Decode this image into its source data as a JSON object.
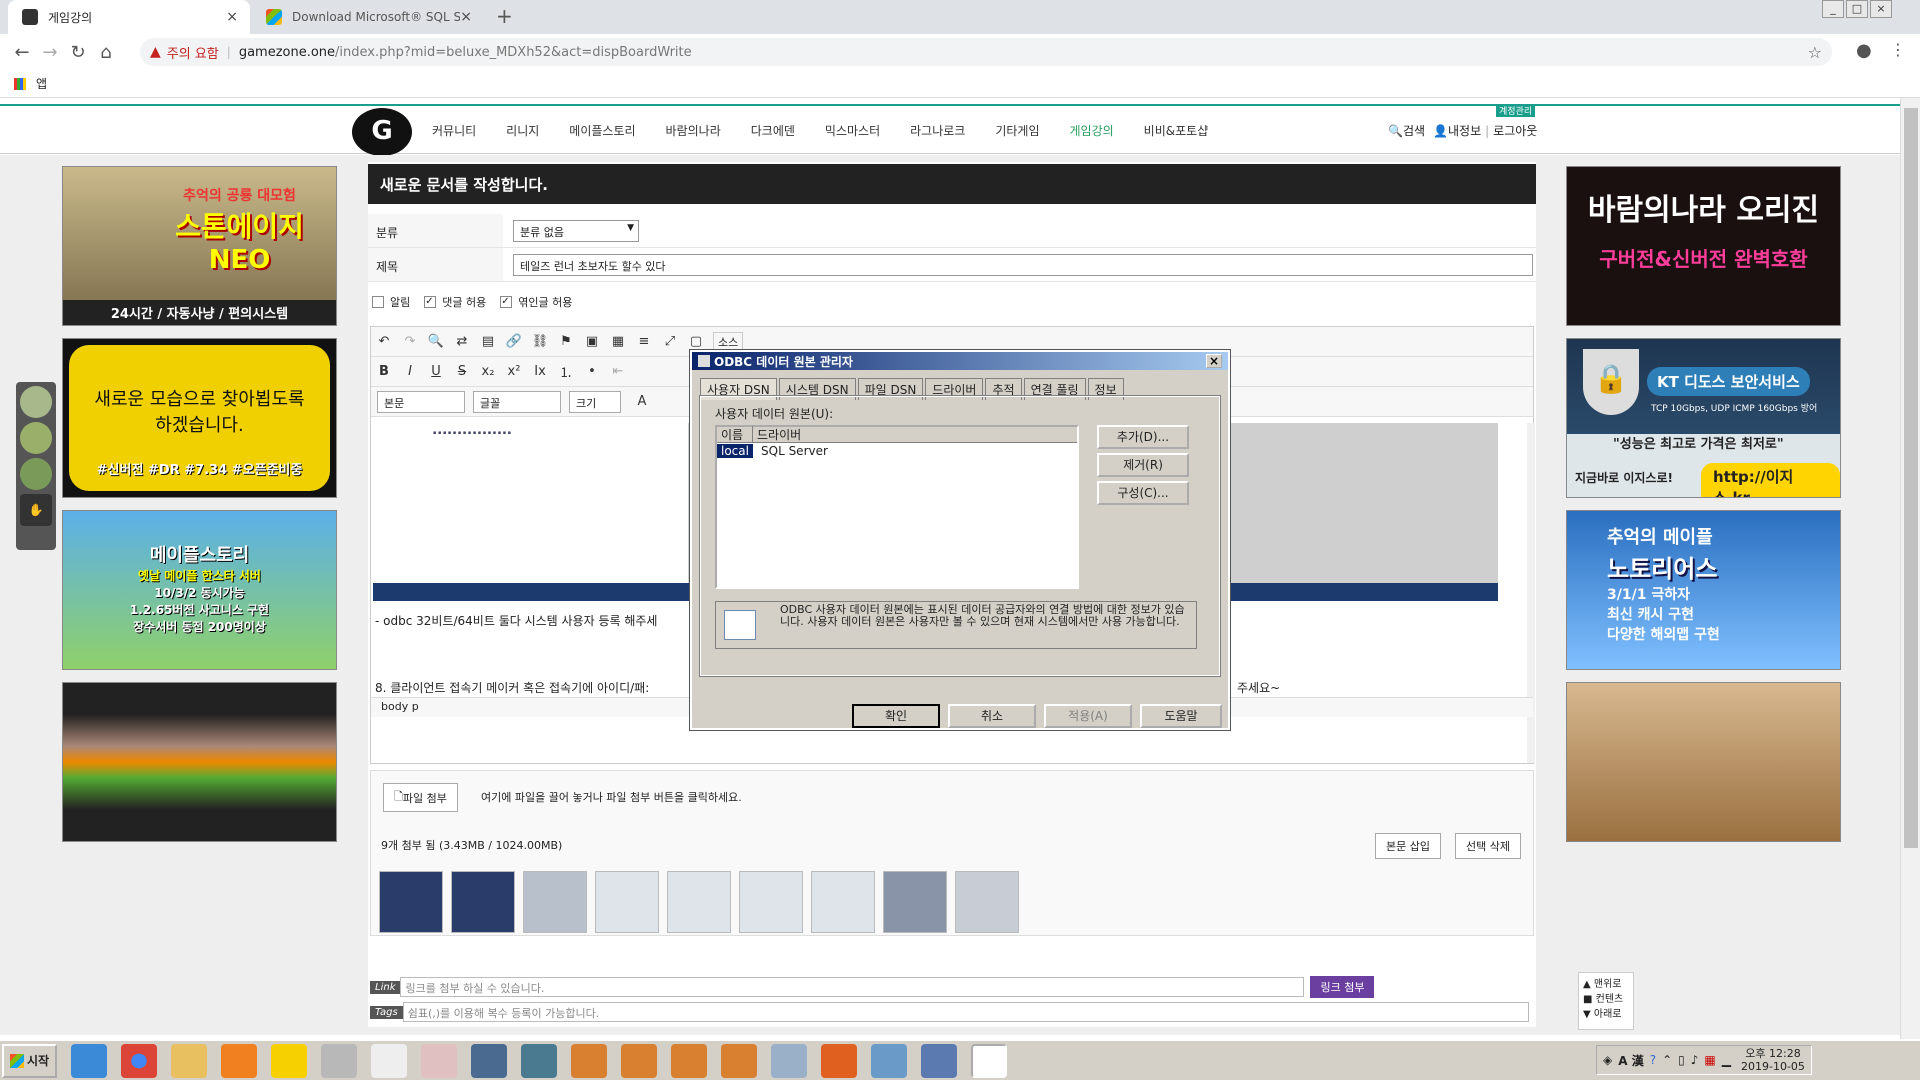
{
  "browser": {
    "tabs": [
      {
        "title": "게임강의",
        "close": "×"
      },
      {
        "title": "Download Microsoft® SQL Ser",
        "close": "×"
      }
    ],
    "new_tab": "+",
    "security_warning": "주의 요함",
    "url_host": "gamezone.one",
    "url_path": "/index.php?mid=beluxe_MDXh52&act=dispBoardWrite",
    "bookmark_apps": "앱",
    "window_controls": [
      "_",
      "□",
      "×"
    ]
  },
  "site": {
    "menu": [
      "커뮤니티",
      "리니지",
      "메이플스토리",
      "바람의나라",
      "다크에덴",
      "믹스마스터",
      "라그나로크",
      "기타게임",
      "게임강의",
      "비비&포토샵"
    ],
    "active_menu": "게임강의",
    "header_links": {
      "search": "검색",
      "myinfo": "내정보",
      "logout": "로그아웃"
    },
    "new_badge": "계정관리"
  },
  "left_ads": [
    {
      "top": "추억의 공룡 대모험",
      "title": "스톤에이지",
      "sub": "NEO",
      "footer": "24시간 / 자동사냥 / 편의시스템"
    },
    {
      "title": "새로운 모습으로 찾아뵙도록 하겠습니다.",
      "footer": "#신버전 #DR #7.34 #오픈준비중"
    },
    {
      "title": "메이플스토리",
      "line1": "옛날 메이플 한스타 서버",
      "line2": "10/3/2 동시가능",
      "line3": "1.2.65버전 사고니스 구현",
      "line4": "장수서버 동접 200명이상"
    },
    {
      "title": ""
    }
  ],
  "right_ads": [
    {
      "title": "바람의나라 오리진",
      "sub": "구버전&신버전 완벽호환"
    },
    {
      "title": "KT 디도스 보안서비스",
      "spec": "TCP 10Gbps, UDP ICMP 160Gbps 방어",
      "slogan": "\"성능은 최고로 가격은 최저로\"",
      "cta_label": "지금바로 이지스로!",
      "cta": "http://이지스.kr"
    },
    {
      "title": "추억의 메이플",
      "sub": "노토리어스",
      "line1": "3/1/1 극하자",
      "line2": "최신 캐시 구현",
      "line3": "다양한 해외맵 구현"
    },
    {
      "title": ""
    }
  ],
  "editor": {
    "page_title": "새로운 문서를 작성합니다.",
    "category_label": "분류",
    "category_value": "분류 없음",
    "subject_label": "제목",
    "subject_value": "테일즈 런너 초보자도 할수 있다",
    "opt_notice": "알림",
    "opt_comment": "댓글 허용",
    "opt_trackback": "엮인글 허용",
    "source_label": "소스",
    "format_select": "본문",
    "font_select": "글꼴",
    "size_select": "크기",
    "body_line1": "- odbc 32비트/64비트 둘다 시스템 사용자 등록 해주세",
    "body_line2": "8. 클라이언트 접속기 메이커 혹은 접속기에 아이디/패:",
    "body_line2_tail": "주세요~",
    "status_path": "body  p",
    "file_attach_btn": "파일 첨부",
    "file_drop_hint": "여기에 파일을 끌어 놓거나 파일 첨부 버튼을 클릭하세요.",
    "file_count": "9개 첨부 됨 (3.43MB / 1024.00MB)",
    "insert_btn": "본문 삽입",
    "delete_btn": "선택 삭제",
    "link_tag": "Link",
    "link_placeholder": "링크를 첨부 하실 수 있습니다.",
    "link_btn": "링크 첨부",
    "tags_tag": "Tags",
    "tags_placeholder": "쉼표(,)를 이용해 복수 등록이 가능합니다."
  },
  "float_menu": [
    "▲ 맨위로",
    "■ 컨텐츠",
    "▼ 아래로"
  ],
  "dialog": {
    "title": "ODBC 데이터 원본 관리자",
    "tabs": [
      "사용자 DSN",
      "시스템 DSN",
      "파일 DSN",
      "드라이버",
      "추적",
      "연결 풀링",
      "정보"
    ],
    "list_label": "사용자 데이터 원본(U):",
    "col_name": "이름",
    "col_driver": "드라이버",
    "row_name": "local",
    "row_driver": "SQL Server",
    "btn_add": "추가(D)...",
    "btn_remove": "제거(R)",
    "btn_config": "구성(C)...",
    "info_text": "ODBC 사용자 데이터 원본에는 표시된 데이터 공급자와의 연결 방법에 대한 정보가 있습니다. 사용자 데이터 원본은 사용자만 볼 수 있으며 현재 시스템에서만 사용 가능합니다.",
    "btn_ok": "확인",
    "btn_cancel": "취소",
    "btn_apply": "적용(A)",
    "btn_help": "도움말"
  },
  "taskbar": {
    "start": "시작",
    "tray_lang": "A 漢",
    "clock_time": "오후 12:28",
    "clock_date": "2019-10-05"
  },
  "colors": {
    "accent": "#1a9e8c",
    "active_menu": "#2a9d5c",
    "link_btn": "#6b3fa0",
    "dialog_title": "#0a246a"
  }
}
